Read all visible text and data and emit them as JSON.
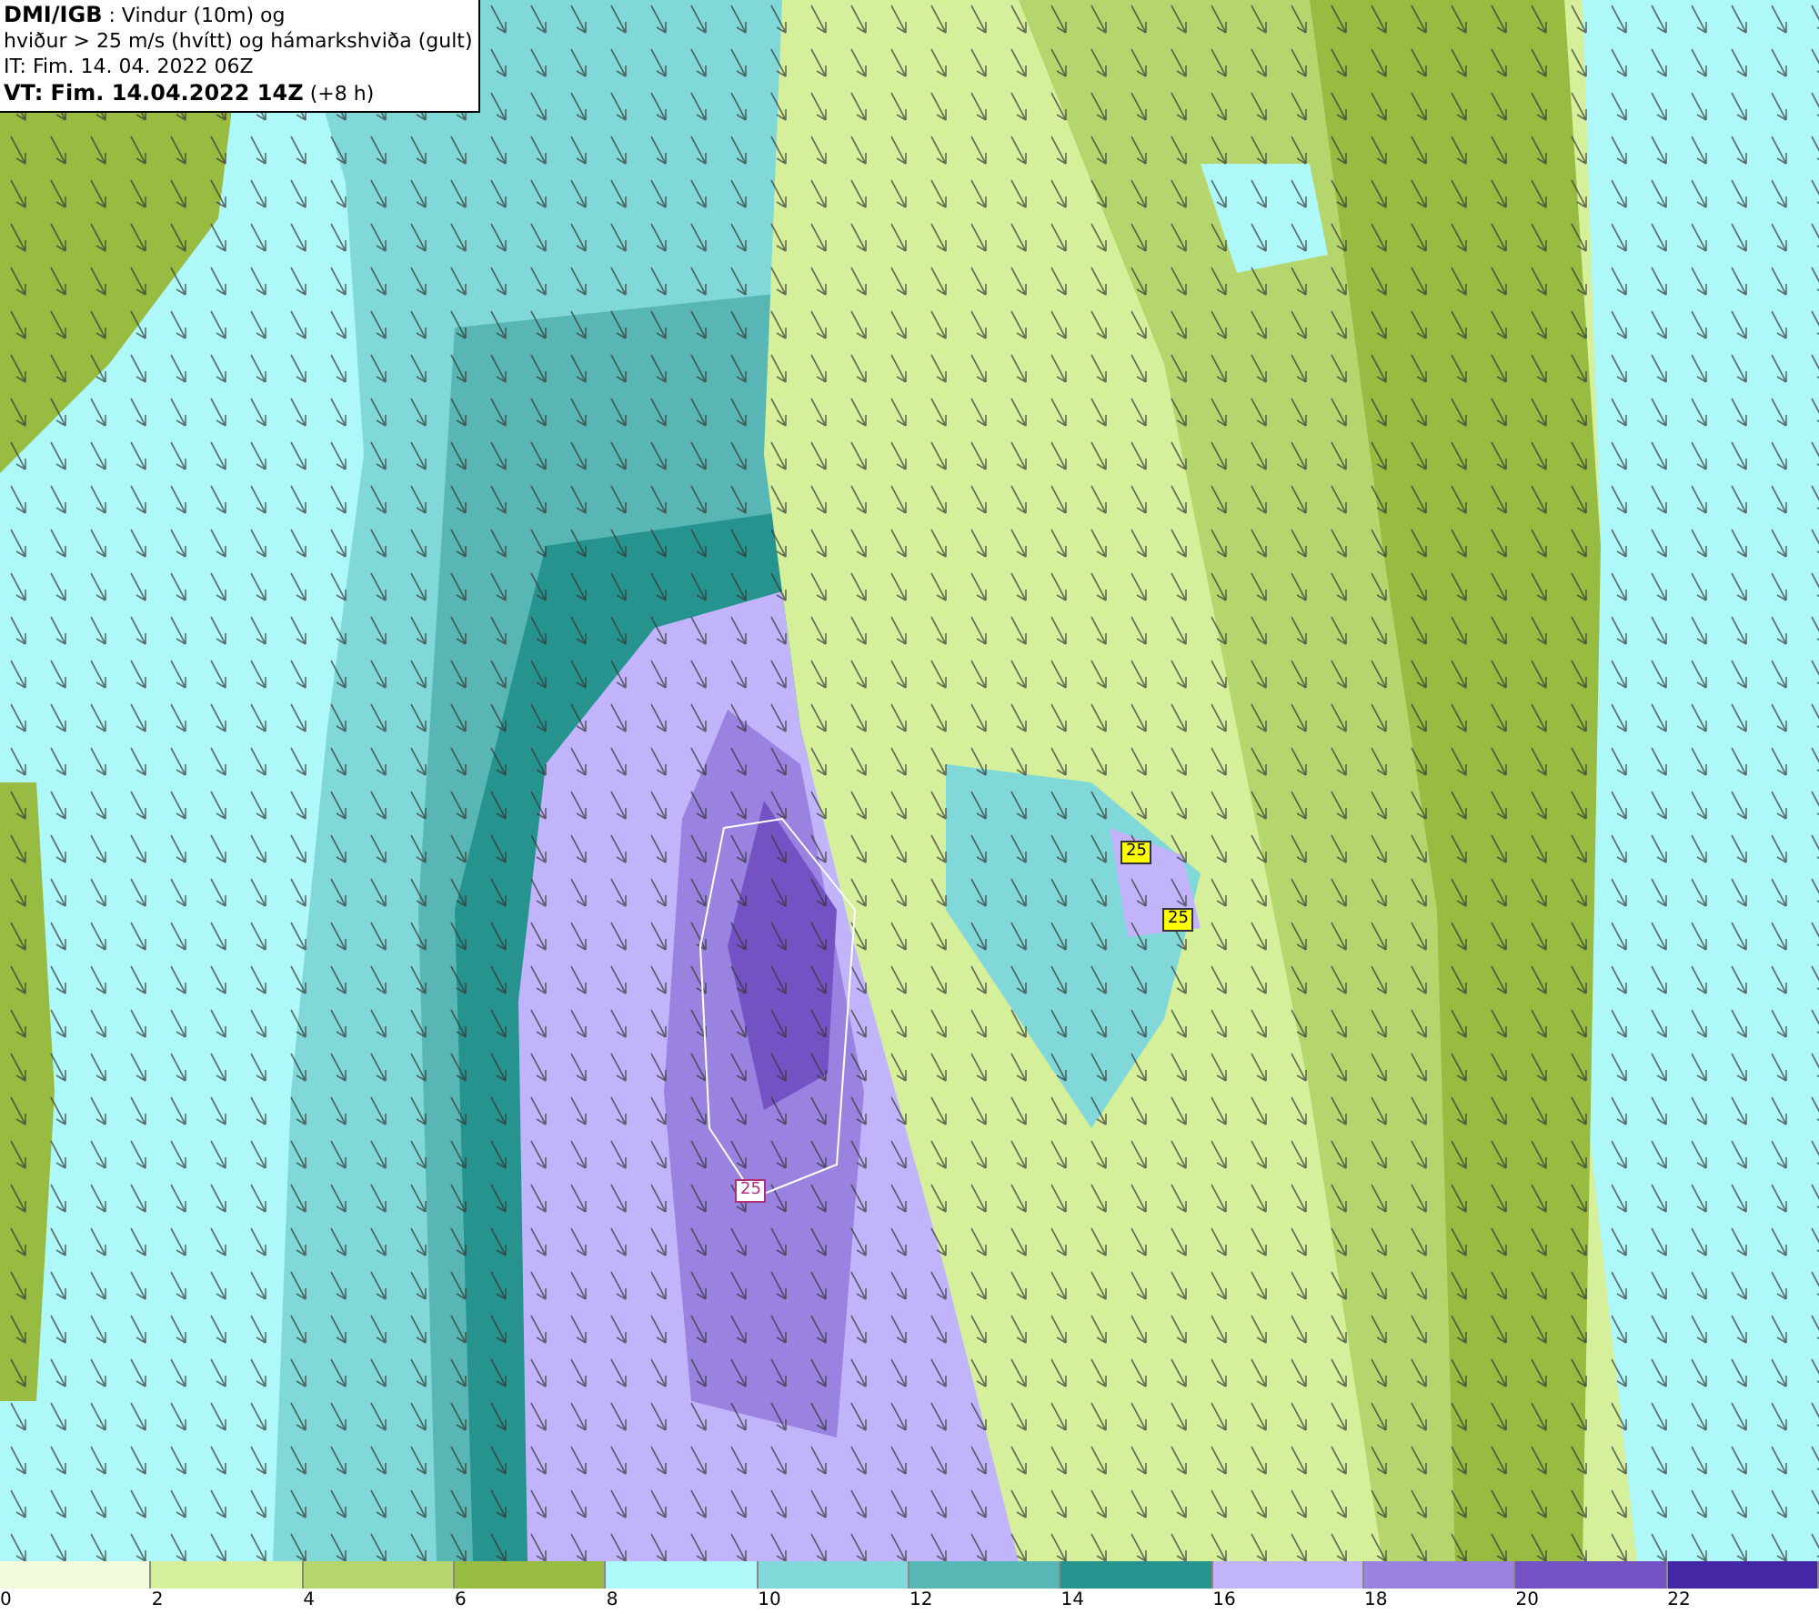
{
  "header": {
    "lines": [
      "**DMI/IGB** : Vindur (10m) og",
      "hviður > 25 m/s (hvítt) og hámarkshviða (gult)",
      "IT: Fim. 14. 04. 2022 06Z",
      "**VT: Fim. 14.04.2022 14Z** (+8 h)"
    ]
  },
  "map": {
    "labels": [
      {
        "text": "25",
        "kind": "gust-max"
      },
      {
        "text": "25",
        "kind": "gust-max"
      },
      {
        "text": "25",
        "kind": "gust"
      }
    ]
  },
  "legend": {
    "bins": [
      {
        "color": "#f2fbdc"
      },
      {
        "color": "#d6ef9a"
      },
      {
        "color": "#b5d66c"
      },
      {
        "color": "#98bb42"
      },
      {
        "color": "#aef8fa"
      },
      {
        "color": "#80d8d8"
      },
      {
        "color": "#58b7b5"
      },
      {
        "color": "#26938f"
      },
      {
        "color": "#c2b4fb"
      },
      {
        "color": "#9a82e0"
      },
      {
        "color": "#7352c4"
      },
      {
        "color": "#4327a4"
      }
    ],
    "ticks": [
      "0",
      "2",
      "4",
      "6",
      "8",
      "10",
      "12",
      "14",
      "16",
      "18",
      "20",
      "22"
    ]
  }
}
